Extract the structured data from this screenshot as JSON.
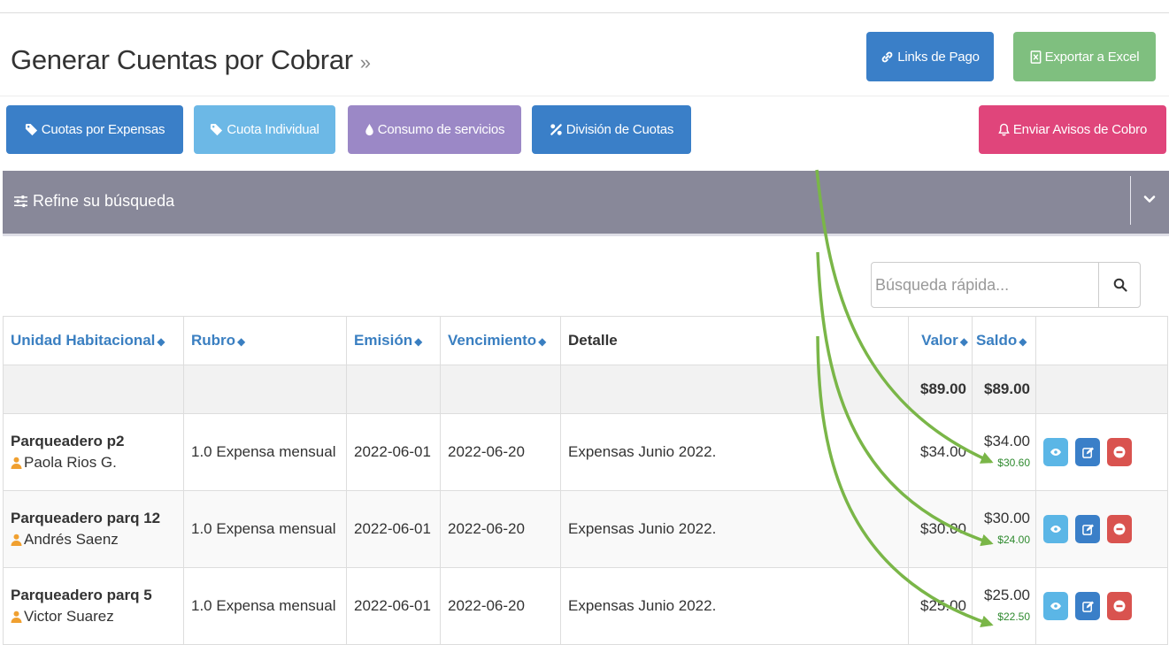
{
  "header": {
    "title": "Generar Cuentas por Cobrar",
    "title_suffix": "»",
    "links_pago_label": "Links de Pago",
    "exportar_label": "Exportar a Excel"
  },
  "toolbar": {
    "cuotas_expensas_label": "Cuotas por Expensas",
    "cuota_individual_label": "Cuota Individual",
    "consumo_servicios_label": "Consumo de servicios",
    "division_cuotas_label": "División de Cuotas",
    "enviar_avisos_label": "Enviar Avisos de Cobro"
  },
  "filter": {
    "label": "Refine su búsqueda"
  },
  "search": {
    "placeholder": "Búsqueda rápida..."
  },
  "table": {
    "headers": {
      "unidad": "Unidad Habitacional",
      "rubro": "Rubro",
      "emision": "Emisión",
      "vencimiento": "Vencimiento",
      "detalle": "Detalle",
      "valor": "Valor",
      "saldo": "Saldo"
    },
    "totals": {
      "valor": "$89.00",
      "saldo": "$89.00"
    },
    "rows": [
      {
        "unidad": "Parqueadero p2",
        "propietario": "Paola Rios G.",
        "rubro": "1.0 Expensa mensual",
        "emision": "2022-06-01",
        "vencimiento": "2022-06-20",
        "detalle": "Expensas Junio 2022.",
        "valor": "$34.00",
        "saldo": "$34.00",
        "saldo_pagado": "$30.60"
      },
      {
        "unidad": "Parqueadero parq 12",
        "propietario": "Andrés Saenz",
        "rubro": "1.0 Expensa mensual",
        "emision": "2022-06-01",
        "vencimiento": "2022-06-20",
        "detalle": "Expensas Junio 2022.",
        "valor": "$30.00",
        "saldo": "$30.00",
        "saldo_pagado": "$24.00"
      },
      {
        "unidad": "Parqueadero parq 5",
        "propietario": "Victor Suarez",
        "rubro": "1.0 Expensa mensual",
        "emision": "2022-06-01",
        "vencimiento": "2022-06-20",
        "detalle": "Expensas Junio 2022.",
        "valor": "$25.00",
        "saldo": "$25.00",
        "saldo_pagado": "$22.50"
      }
    ]
  },
  "icons": {
    "links": "link-icon",
    "excel": "excel-file-icon",
    "tag": "tag-icon",
    "drop": "drop-icon",
    "percent": "percent-icon",
    "bell": "bell-icon",
    "sliders": "sliders-icon",
    "chevron": "chevron-down-icon",
    "search": "search-icon",
    "user": "user-icon",
    "view": "eye-icon",
    "edit": "edit-icon",
    "delete": "minus-circle-icon"
  },
  "colors": {
    "primary": "#3a7fc8",
    "info": "#6cb8e6",
    "purple": "#9b88c6",
    "success": "#7fbf7f",
    "danger": "#e0457b",
    "filter_bar": "#888899",
    "annotation_arrow": "#7ab648",
    "paid_text": "#2f8a2f",
    "owner_icon": "#f0a030"
  }
}
